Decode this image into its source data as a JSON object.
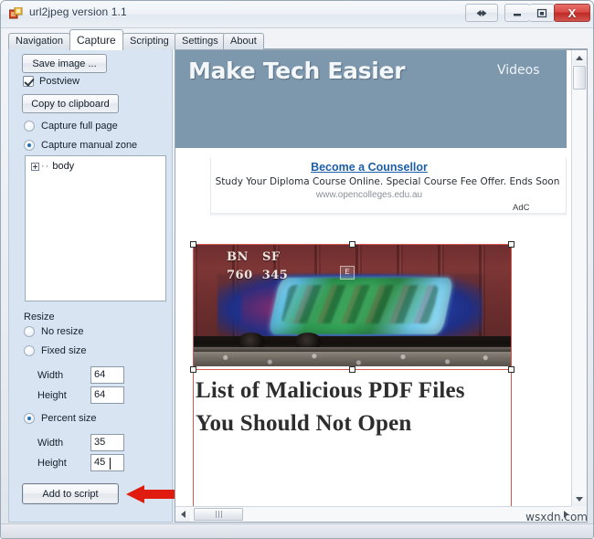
{
  "window": {
    "title": "url2jpeg version 1.1",
    "icon": "app-icon",
    "buttons": {
      "resize": "⇔",
      "minimize": "▬",
      "maximize": "❐",
      "close": "X"
    }
  },
  "tabs": [
    {
      "label": "Navigation",
      "active": false
    },
    {
      "label": "Capture",
      "active": true
    },
    {
      "label": "Scripting",
      "active": false
    },
    {
      "label": "Settings",
      "active": false
    },
    {
      "label": "About",
      "active": false
    }
  ],
  "panel": {
    "save_image_label": "Save image ...",
    "postview_label": "Postview",
    "postview_checked": true,
    "copy_clipboard_label": "Copy to clipboard",
    "capture_full_page_label": "Capture full page",
    "capture_manual_zone_label": "Capture manual zone",
    "capture_mode_selected": "Capture manual zone",
    "tree": {
      "root_label": "body",
      "dots": "··"
    },
    "resize": {
      "legend": "Resize",
      "no_resize_label": "No resize",
      "fixed_size_label": "Fixed size",
      "percent_size_label": "Percent size",
      "selected": "Percent size",
      "fixed": {
        "width_label": "Width",
        "width_value": "64",
        "height_label": "Height",
        "height_value": "64"
      },
      "percent": {
        "width_label": "Width",
        "width_value": "35",
        "height_label": "Height",
        "height_value": "45"
      }
    },
    "add_to_script_label": "Add to script"
  },
  "preview": {
    "site": {
      "logo": "Make Tech Easier",
      "videos_link": "Videos"
    },
    "ad": {
      "title": "Become a Counsellor",
      "description": "Study Your Diploma Course Online. Special Course Fee Offer. Ends Soon",
      "url": "www.opencolleges.edu.au",
      "choices": "AdC"
    },
    "photo": {
      "reporting_mark_1": "BN",
      "reporting_mark_2": "SF",
      "number_1": "760",
      "number_2": "345",
      "badge": "E"
    },
    "headline": "List of Malicious PDF Files You Should Not Open",
    "scrollbars": {
      "up_arrow": "▲",
      "down_arrow": "▼",
      "left_arrow": "◄",
      "right_arrow": "►"
    }
  },
  "watermark": "wsxdn.com",
  "colors": {
    "panel_bg": "#d8e4f1",
    "site_header": "#7d97ad",
    "ad_link": "#1c5fa8",
    "selection": "#d4584f",
    "close_button": "#c02a26",
    "radio_dot": "#1f6fba",
    "arrow_annotation": "#e01b10"
  }
}
